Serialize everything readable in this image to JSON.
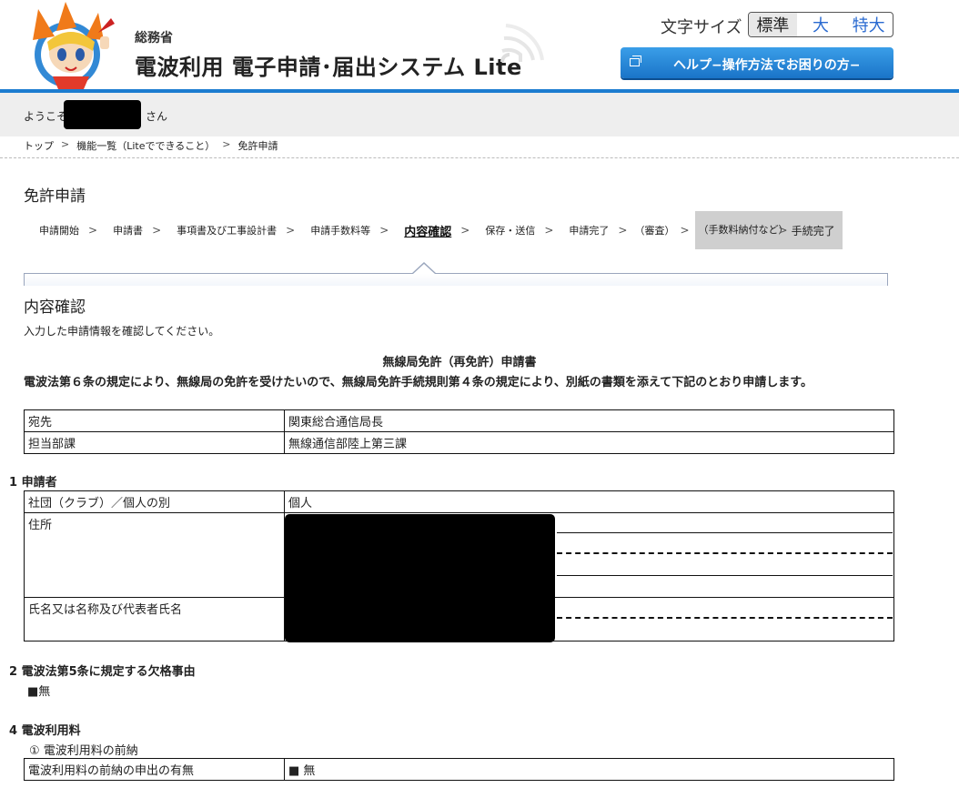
{
  "header": {
    "ministry": "総務省",
    "system_title": "電波利用 電子申請･届出システム Lite",
    "font_size_label": "文字サイズ",
    "font_sizes": [
      "標準",
      "大",
      "特大"
    ],
    "help_button": "ヘルプ−操作方法でお困りの方−",
    "accent_color": "#1c7cd0"
  },
  "welcome": {
    "prefix": "ようこそ",
    "suffix": "さん"
  },
  "breadcrumb": [
    "トップ",
    "機能一覧（Liteでできること）",
    "免許申請"
  ],
  "page_title": "免許申請",
  "steps": {
    "items": [
      "申請開始",
      "申請書",
      "事項書及び工事設計書",
      "申請手数料等",
      "内容確認",
      "保存・送信",
      "申請完了",
      "（審査）"
    ],
    "fee_step": "（手数料納付など）",
    "final_step": "手続完了"
  },
  "section_title": "内容確認",
  "instruction": "入力した申請情報を確認してください。",
  "form": {
    "title": "無線局免許（再免許）申請書",
    "statement": "電波法第６条の規定により、無線局の免許を受けたいので、無線局免許手続規則第４条の規定により、別紙の書類を添えて下記のとおり申請します。"
  },
  "table_dest": [
    {
      "key": "宛先",
      "value": "関東総合通信局長"
    },
    {
      "key": "担当部課",
      "value": "無線通信部陸上第三課"
    }
  ],
  "applicant": {
    "heading": "1 申請者",
    "rows": [
      {
        "key": "社団（クラブ）／個人の別",
        "value": "個人"
      },
      {
        "key": "住所",
        "value": ""
      },
      {
        "key": "氏名又は名称及び代表者氏名",
        "value": ""
      }
    ]
  },
  "disqualification": {
    "heading": "2 電波法第5条に規定する欠格事由",
    "value": "■無"
  },
  "usage_fee": {
    "heading": "4 電波利用料",
    "sub": "① 電波利用料の前納",
    "rows": [
      {
        "key": "電波利用料の前納の申出の有無",
        "value": "■ 無"
      }
    ]
  }
}
